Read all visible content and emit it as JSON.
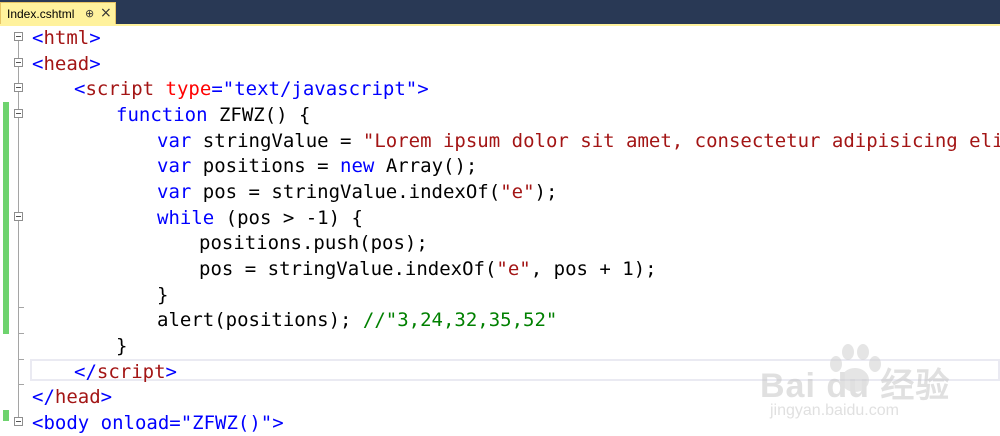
{
  "tab": {
    "title": "Index.cshtml",
    "pin": "⊕",
    "close": "×"
  },
  "colors": {
    "tab_strip": "#293955",
    "active_tab": "#fff29d",
    "keyword": "#0000ff",
    "string": "#a31515",
    "attribute": "#ff0000",
    "comment": "#008000",
    "change_bar": "#6ed36e"
  },
  "code": {
    "l1": {
      "lt": "<",
      "name": "html",
      "gt": ">"
    },
    "l2": {
      "lt": "<",
      "name": "head",
      "gt": ">"
    },
    "l3": {
      "lt": "<",
      "name": "script",
      "attr": "type",
      "eq": "=",
      "val": "\"text/javascript\"",
      "gt": ">"
    },
    "l4": {
      "kw": "function",
      "rest": " ZFWZ() {"
    },
    "l5": {
      "kw": "var",
      "rest": " stringValue = ",
      "str": "\"Lorem ipsum dolor sit amet, consectetur adipisicing elit\"",
      "end": ";"
    },
    "l6": {
      "kw": "var",
      "rest": " positions = ",
      "kw2": "new",
      "rest2": " Array();"
    },
    "l7": {
      "kw": "var",
      "rest": " pos = stringValue.indexOf(",
      "str": "\"e\"",
      "end": ");"
    },
    "l8": {
      "kw": "while",
      "rest": " (pos > -1) {"
    },
    "l9": {
      "text": "positions.push(pos);"
    },
    "l10": {
      "rest": "pos = stringValue.indexOf(",
      "str": "\"e\"",
      "end": ", pos + 1);"
    },
    "l11": {
      "text": "}"
    },
    "l12": {
      "rest": "alert(positions); ",
      "cm": "//\"3,24,32,35,52\""
    },
    "l13": {
      "text": "}"
    },
    "l14": {
      "lt": "</",
      "name": "script",
      "gt": ">"
    },
    "l15": {
      "lt": "</",
      "name": "head",
      "gt": ">"
    },
    "l16": {
      "partial": "<body onload=\"ZFWZ()\">"
    }
  },
  "watermark": {
    "text": "Bai du 经验",
    "sub": "jingyan.baidu.com",
    "icon": "paw-icon"
  }
}
